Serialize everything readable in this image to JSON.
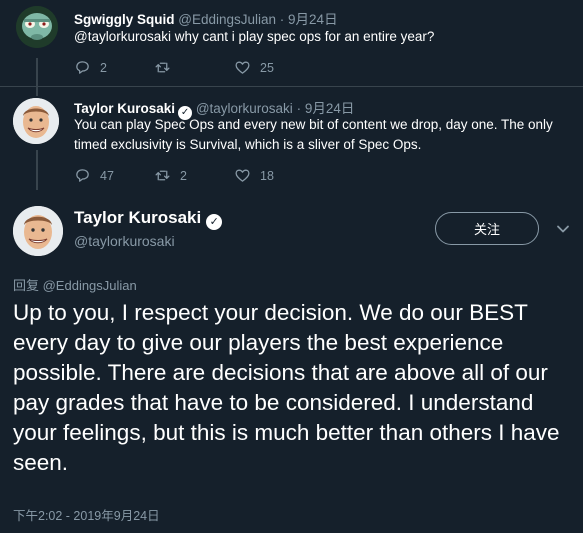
{
  "tweets": [
    {
      "name": "Sgwiggly Squid",
      "handle": "@EddingsJulian",
      "date": "· 9月24日",
      "text": "@taylorkurosaki why cant i play spec ops for an entire year?",
      "reply_count": "2",
      "retweet_count": "",
      "like_count": "25",
      "verified": false
    },
    {
      "name": "Taylor Kurosaki",
      "handle": "@taylorkurosaki",
      "date": "· 9月24日",
      "text": "You can play Spec Ops and every new bit of content we drop, day one. The only timed exclusivity is Survival, which is a sliver of Spec Ops.",
      "reply_count": "47",
      "retweet_count": "2",
      "like_count": "18",
      "verified": true
    }
  ],
  "main": {
    "name": "Taylor Kurosaki",
    "handle": "@taylorkurosaki",
    "follow_label": "关注",
    "reply_to": "回复 @EddingsJulian",
    "text": "Up to you, I respect your decision. We do our BEST every day to give our players the best experience possible. There are decisions that are above all of our pay grades that have to be considered. I understand your feelings, but this is much better than others I have seen.",
    "timestamp": "下午2:02 - 2019年9月24日"
  },
  "icons": {
    "reply": "reply-icon",
    "retweet": "retweet-icon",
    "like": "like-icon",
    "verified": "verified-icon",
    "more": "chevron-down-icon"
  },
  "colors": {
    "background": "#15202b",
    "secondary_text": "#8899a6",
    "divider": "#38444d"
  }
}
